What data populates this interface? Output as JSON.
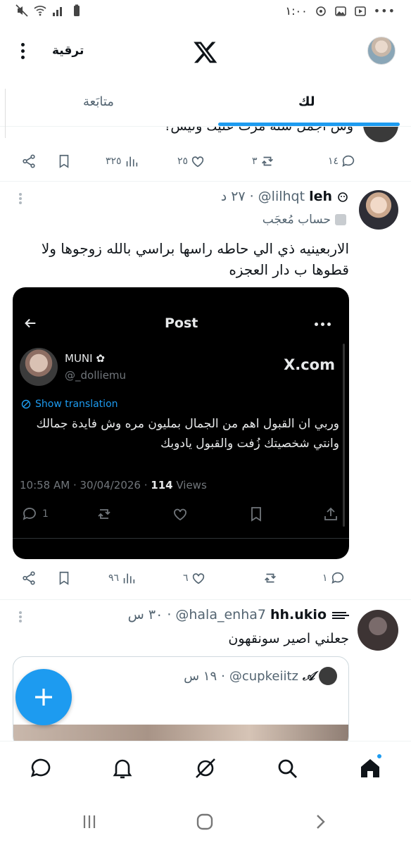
{
  "status_bar": {
    "time": "١:٠٠",
    "dots": "•••"
  },
  "header": {
    "upgrade_label": "ترقية",
    "logo": "X"
  },
  "tabs": {
    "following": "متابَعة",
    "for_you": "لك"
  },
  "posts": [
    {
      "text": "وش اجمل سنه مرت عليك وليش؟",
      "actions": {
        "replies": "١٤",
        "reposts": "٣",
        "likes": "٢٥",
        "views": "٣٢٥"
      }
    },
    {
      "name": "leh",
      "handle": "@lilhqt",
      "time": "٢٧ د",
      "separator": "·",
      "badge": "حساب مُعجَب",
      "text": "الاربعينيه ذي الي حاطه راسها براسي بالله زوجوها ولا قطوها ب دار العجزه",
      "embed": {
        "title": "Post",
        "name": "MUNI ✿",
        "handle": "@_dolliemu",
        "brand": "X.com",
        "translate": "Show translation",
        "text": "وربي ان القبول اهم من الجمال بمليون مره وش فايدة جمالك وانتي شخصيتك زُفت والقبول يادوبك",
        "meta_time": "10:58 AM · 30/04/2026 · ",
        "views_count": "114",
        "views_label": " Views",
        "replies": "1"
      },
      "actions": {
        "replies": "١",
        "reposts": "",
        "likes": "٦",
        "views": "٩٦"
      }
    },
    {
      "name": "hh.ukio",
      "handle": "@hala_enha7",
      "time": "٣٠ س",
      "separator": "·",
      "text": "جعلني اصير سونقهون",
      "quote": {
        "name": "𝒜",
        "handle": "@cupkeiitz",
        "time": "١٩ س",
        "separator": "·"
      }
    }
  ],
  "colors": {
    "accent": "#1d9bf0",
    "text": "#0f1419",
    "muted": "#536471"
  },
  "icons": {
    "nav": [
      "home-icon",
      "search-icon",
      "grok-icon",
      "notifications-icon",
      "messages-icon"
    ],
    "system": [
      "recents-icon",
      "home-circle-icon",
      "back-icon"
    ]
  }
}
